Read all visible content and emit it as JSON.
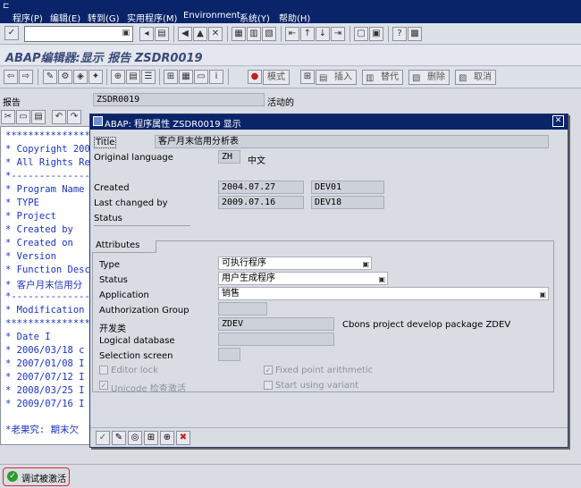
{
  "menu": [
    "程序(P)",
    "编辑(E)",
    "转到(G)",
    "实用程序(M)",
    "Environment",
    "系统(Y)",
    "帮助(H)"
  ],
  "title": "ABAP编辑器:显示 报告 ZSDR0019",
  "app_toolbar": {
    "mode": "模式",
    "insert": "插入",
    "replace": "替代",
    "delete": "删除",
    "cancel": "取消"
  },
  "report_row": {
    "label": "报告",
    "value": "ZSDR0019",
    "status": "活动的"
  },
  "code_lines": [
    "***********************",
    "* Copyright 200",
    "* All Rights Re",
    "*-----------------------",
    "* Program Name",
    "* TYPE",
    "* Project",
    "* Created by",
    "* Created on",
    "* Version",
    "* Function Desc",
    "* 客户月末信用分",
    "*-----------------------",
    "* Modification",
    "***********************",
    "* Date        I",
    "* 2006/03/18  c",
    "* 2007/01/08  I",
    "* 2007/07/12  I",
    "* 2008/03/25  I",
    "* 2009/07/16  I",
    "*老果究: 期末欠"
  ],
  "dialog": {
    "title": "ABAP: 程序属性 ZSDR0019 显示",
    "title_label": "Title",
    "title_value": "客户月末信用分析表",
    "orig_lang_label": "Original language",
    "orig_lang_value": "ZH",
    "orig_lang_text": "中文",
    "created_label": "Created",
    "created_date": "2004.07.27",
    "created_user": "DEV01",
    "changed_label": "Last changed by",
    "changed_date": "2009.07.16",
    "changed_user": "DEV18",
    "status_label": "Status",
    "attributes_tab": "Attributes",
    "type_label": "Type",
    "type_value": "可执行程序",
    "attr_status_label": "Status",
    "attr_status_value": "用户生成程序",
    "application_label": "Application",
    "application_value": "销售",
    "auth_group_label": "Authorization Group",
    "package_label": "开发类",
    "package_value": "ZDEV",
    "package_text": "Cbons project develop package  ZDEV",
    "logical_db_label": "Logical database",
    "selection_screen_label": "Selection screen",
    "editor_lock": "Editor lock",
    "fixed_point": "Fixed point arithmetic",
    "unicode_check": "Unicode 检查激活",
    "start_variant": "Start using variant"
  },
  "status_message": "调试被激活"
}
